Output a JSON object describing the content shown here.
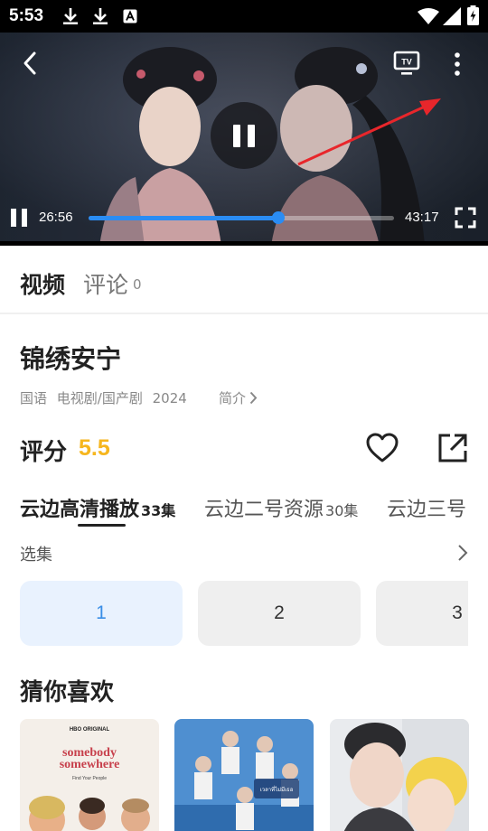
{
  "status_bar": {
    "time": "5:53",
    "notification_icons": [
      "download-icon",
      "download-icon",
      "text-a-icon"
    ],
    "system_icons": [
      "wifi-icon",
      "signal-icon",
      "battery-charging-icon"
    ]
  },
  "player": {
    "state": "playing",
    "current_time": "26:56",
    "total_time": "43:17",
    "progress": 0.62,
    "buttons": {
      "back": "chevron-left-icon",
      "cast": "tv-icon",
      "cast_label": "TV",
      "more": "more-vertical-icon",
      "fullscreen": "fullscreen-icon"
    },
    "accent_color": "#2a8cf3"
  },
  "tabs": {
    "video_label": "视频",
    "comments_label": "评论",
    "comments_count": "0"
  },
  "detail": {
    "title": "锦绣安宁",
    "language": "国语",
    "genre": "电视剧/国产剧",
    "year": "2024",
    "intro_label": "简介",
    "rating_label": "评分",
    "rating_value": "5.5",
    "rating_color": "#f6b61e"
  },
  "sources": [
    {
      "name": "云边高清播放",
      "count": "33集",
      "active": true
    },
    {
      "name": "云边二号资源",
      "count": "30集",
      "active": false
    },
    {
      "name": "云边三号",
      "count": "",
      "active": false
    }
  ],
  "episodes": {
    "label": "选集",
    "items": [
      "1",
      "2",
      "3"
    ],
    "selected": "1",
    "active_color": "#3a8ee6"
  },
  "recommendations": {
    "title": "猜你喜欢",
    "items": [
      {
        "brand": "HBO ORIGINAL",
        "title": "somebody somewhere",
        "tagline": "Find Your People"
      },
      {
        "poster_caption": "เวลาที่ไม่มีเธอ"
      },
      {
        "poster_caption": ""
      }
    ]
  }
}
